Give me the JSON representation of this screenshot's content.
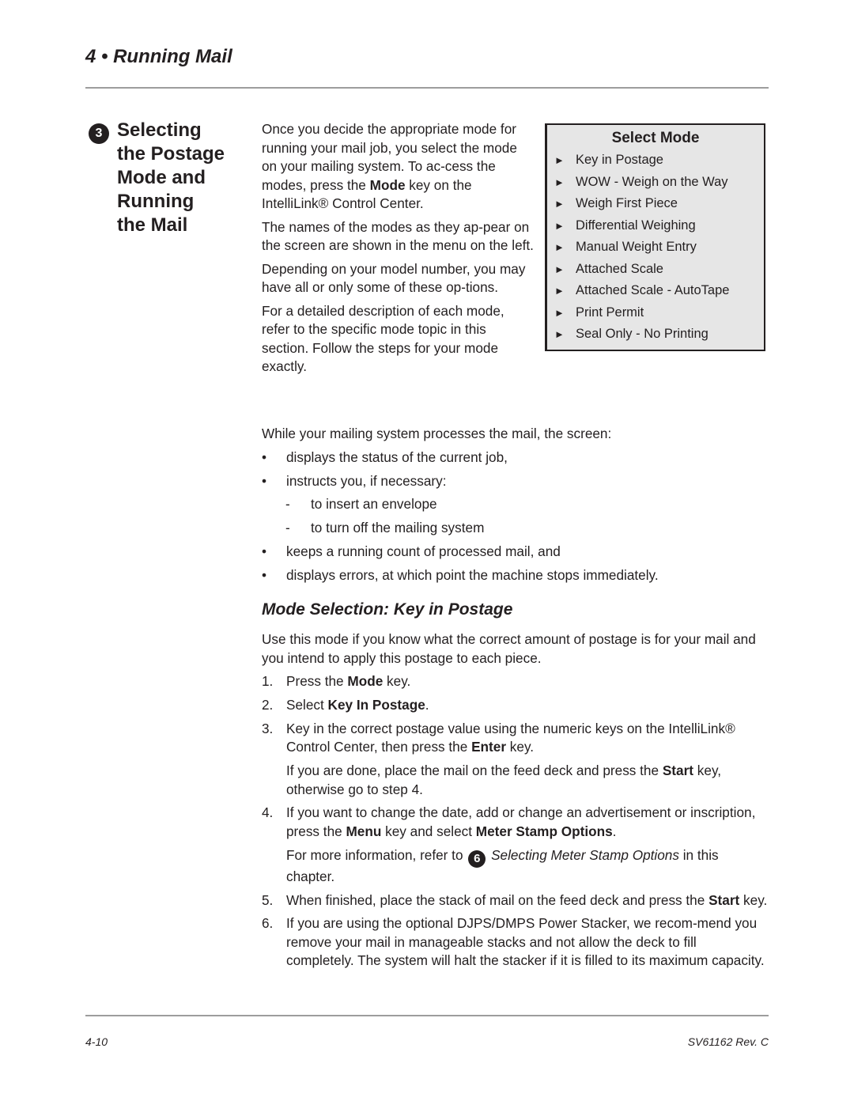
{
  "header": {
    "chapter_title": "4 • Running Mail"
  },
  "section": {
    "number": "3",
    "title_lines": [
      "Selecting",
      "the Postage",
      "Mode and",
      "Running",
      "the Mail"
    ]
  },
  "intro": {
    "p1_a": "Once you decide the appropriate mode for running your mail job, you select the mode on your mailing system. To ac-cess the modes, press the ",
    "p1_bold": "Mode",
    "p1_b": " key on the IntelliLink® Control Center.",
    "p2": "The names of the modes as they ap-pear on the screen are shown in the menu on the left.",
    "p3": "Depending on your model number, you may have all or only some of these op-tions.",
    "p4": "For a detailed description of each mode, refer to the specific mode topic in this section. Follow the steps for your mode exactly."
  },
  "select_mode_box": {
    "title": "Select Mode",
    "arrow_glyph": "►",
    "items": [
      "Key in Postage",
      "WOW - Weigh on the Way",
      "Weigh First Piece",
      "Differential Weighing",
      "Manual Weight Entry",
      "Attached Scale",
      "Attached Scale - AutoTape",
      "Print Permit",
      "Seal Only - No Printing"
    ]
  },
  "processing": {
    "lead": "While your mailing system processes the mail, the screen:",
    "bullet": "•",
    "dash": "-",
    "b1": "displays the status of the current job,",
    "b2": "instructs you, if necessary:",
    "sub1": "to insert an envelope",
    "sub2": "to turn off the mailing system",
    "b3": "keeps a running count of processed mail, and",
    "b4": "displays errors, at which point the machine stops immediately."
  },
  "mode_selection": {
    "title": "Mode Selection: Key in Postage",
    "intro": "Use this mode if you know what the correct amount of postage is for your mail and you intend to apply this postage to each piece.",
    "step1": {
      "num": "1.",
      "a": "Press the ",
      "bold": "Mode",
      "b": " key."
    },
    "step2": {
      "num": "2.",
      "a": "Select ",
      "bold": "Key In Postage",
      "b": "."
    },
    "step3": {
      "num": "3.",
      "a": "Key in the correct postage value using the numeric keys on the IntelliLink® Control Center, then press the ",
      "bold": "Enter",
      "b": " key.",
      "note_a": "If you are done, place the mail on the feed deck and press the ",
      "note_bold": "Start",
      "note_b": " key, otherwise go to step 4."
    },
    "step4": {
      "num": "4.",
      "a": "If you want to change the date, add or change an advertisement or inscription, press the ",
      "bold1": "Menu",
      "b": " key and select ",
      "bold2": "Meter Stamp Options",
      "c": ".",
      "note_a": "For more information, refer to ",
      "note_ref_num": "6",
      "note_italic": "Selecting Meter Stamp Options",
      "note_b": " in this chapter."
    },
    "step5": {
      "num": "5.",
      "a": "When finished, place the stack of mail on the feed deck and press the ",
      "bold": "Start",
      "b": " key."
    },
    "step6": {
      "num": "6.",
      "text": "If you are using the optional DJPS/DMPS Power Stacker, we recom-mend you remove your mail in manageable stacks and not allow the deck to fill completely. The system will halt the stacker if it is filled to its maximum capacity."
    }
  },
  "footer": {
    "page_number": "4-10",
    "doc_id": "SV61162 Rev. C"
  }
}
